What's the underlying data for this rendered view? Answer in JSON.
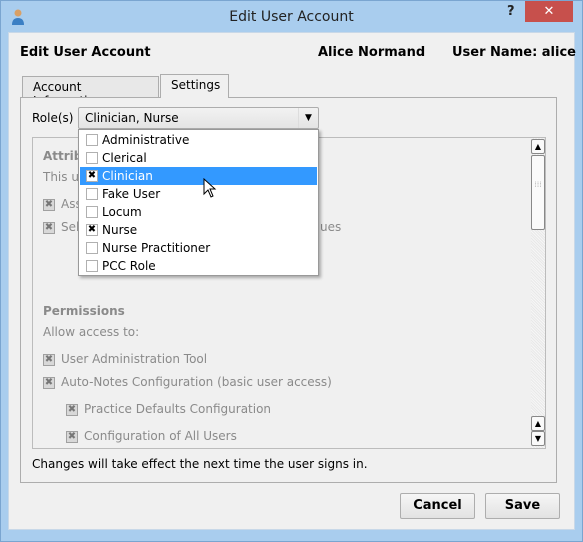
{
  "window": {
    "title": "Edit User Account",
    "help_label": "?",
    "close_label": "✕"
  },
  "header": {
    "title": "Edit User Account",
    "full_name": "Alice Normand",
    "user_name": "User Name: alice"
  },
  "tabs": [
    {
      "label": "Account Information",
      "active": false
    },
    {
      "label": "Settings",
      "active": true
    }
  ],
  "roles": {
    "label": "Role(s)",
    "value": "Clinician, Nurse",
    "options": [
      {
        "label": "Administrative",
        "checked": false
      },
      {
        "label": "Clerical",
        "checked": false
      },
      {
        "label": "Clinician",
        "checked": true,
        "highlighted": true
      },
      {
        "label": "Fake User",
        "checked": false
      },
      {
        "label": "Locum",
        "checked": false
      },
      {
        "label": "Nurse",
        "checked": true
      },
      {
        "label": "Nurse Practitioner",
        "checked": false
      },
      {
        "label": "PCC Role",
        "checked": false
      }
    ]
  },
  "attributes": {
    "heading_fragment": "Attrib",
    "desc_fragment": "This u",
    "item1_fragment": "Ass",
    "item2_fragment": "Sel",
    "item2_tail_fragment": "ues"
  },
  "permissions": {
    "heading": "Permissions",
    "subheading": "Allow access to:",
    "items": [
      {
        "label": "User Administration Tool",
        "checked": true
      },
      {
        "label": "Auto-Notes Configuration (basic user access)",
        "checked": true
      },
      {
        "label": "Practice Defaults Configuration",
        "checked": true
      },
      {
        "label": "Configuration of All Users",
        "checked": true
      }
    ]
  },
  "footer_note": "Changes will take effect the next time the user signs in.",
  "buttons": {
    "cancel": "Cancel",
    "save": "Save"
  },
  "colors": {
    "titlebar": "#a9cdee",
    "close": "#c7504c",
    "highlight": "#3399ff"
  }
}
